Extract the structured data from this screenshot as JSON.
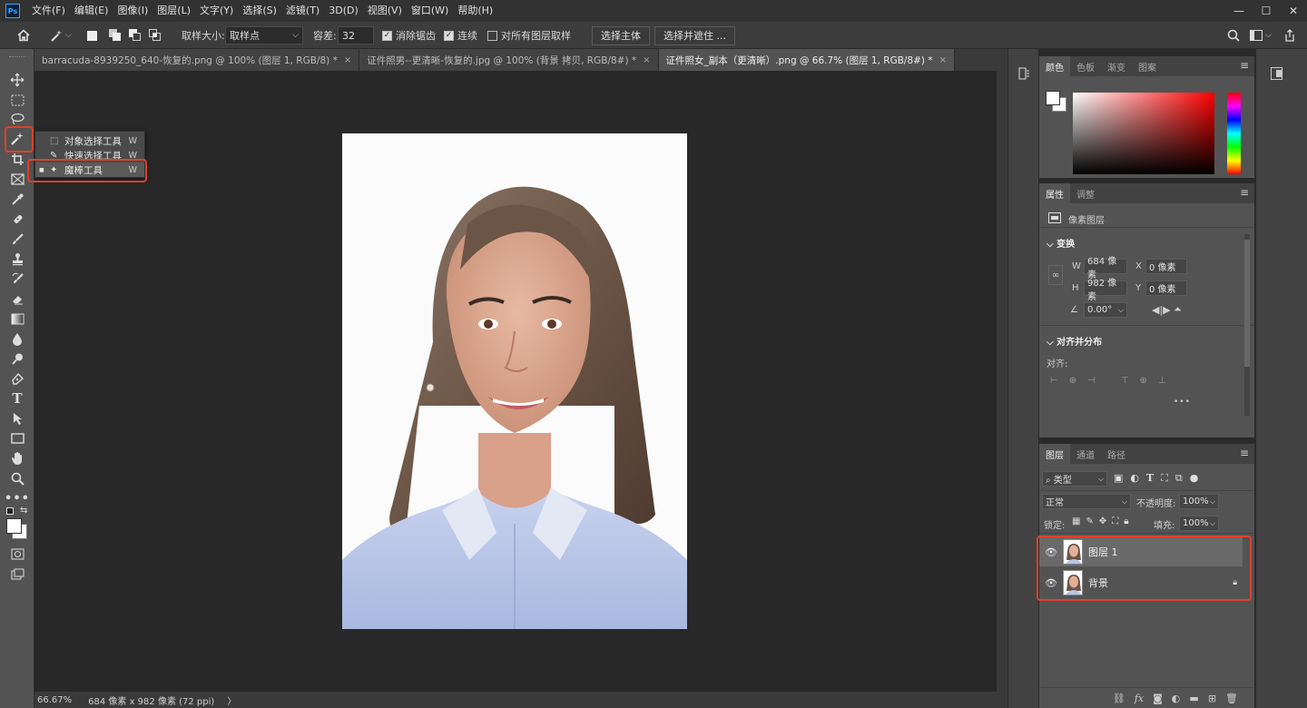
{
  "app": {
    "logo_text": "Ps",
    "accent": "#31a8ff",
    "highlight_color": "#e0402a"
  },
  "menu": [
    "文件(F)",
    "编辑(E)",
    "图像(I)",
    "图层(L)",
    "文字(Y)",
    "选择(S)",
    "滤镜(T)",
    "3D(D)",
    "视图(V)",
    "窗口(W)",
    "帮助(H)"
  ],
  "window_controls": [
    "minimize-icon",
    "restore-icon",
    "close-icon"
  ],
  "options": {
    "home_icon": "home-icon",
    "sample_size_label": "取样大小:",
    "sample_size_value": "取样点",
    "tolerance_label": "容差:",
    "tolerance_value": "32",
    "anti_alias_label": "消除锯齿",
    "anti_alias_checked": true,
    "contiguous_label": "连续",
    "contiguous_checked": true,
    "sample_all_label": "对所有图层取样",
    "sample_all_checked": false,
    "select_subject": "选择主体",
    "select_mask": "选择并遮住 ..."
  },
  "tabs": [
    {
      "label": "barracuda-8939250_640-恢复的.png @ 100% (图层 1, RGB/8) *",
      "close": "×",
      "active": false
    },
    {
      "label": "证件照男--更清晰-恢复的.jpg @ 100% (背景 拷贝, RGB/8#) *",
      "close": "×",
      "active": false
    },
    {
      "label": "证件照女_副本（更清晰）.png @ 66.7% (图层 1, RGB/8#) *",
      "close": "×",
      "active": true
    }
  ],
  "flyout": {
    "items": [
      {
        "label": "对象选择工具",
        "key": "W",
        "icon": "object-select-icon"
      },
      {
        "label": "快速选择工具",
        "key": "W",
        "icon": "quick-select-icon"
      },
      {
        "label": "魔棒工具",
        "key": "W",
        "icon": "magic-wand-icon",
        "selected": true
      }
    ]
  },
  "status": {
    "zoom": "66.67%",
    "info": "684 像素 x 982 像素 (72 ppi)",
    "arrow": "〉"
  },
  "color_panel": {
    "tabs": [
      "颜色",
      "色板",
      "渐变",
      "图案"
    ],
    "active": "颜色",
    "hue": "#ff0000"
  },
  "properties": {
    "tabs": [
      "属性",
      "调整"
    ],
    "active": "属性",
    "type": "像素图层",
    "transform_title": "变换",
    "w_label": "W",
    "w_value": "684 像素",
    "x_label": "X",
    "x_value": "0 像素",
    "h_label": "H",
    "h_value": "982 像素",
    "y_label": "Y",
    "y_value": "0 像素",
    "angle_value": "0.00°",
    "align_title": "对齐并分布",
    "align_label": "对齐:",
    "more": "•••",
    "cut_text": "... ..."
  },
  "layers": {
    "tabs": [
      "图层",
      "通道",
      "路径"
    ],
    "active": "图层",
    "filter_value": "类型",
    "blend_mode": "正常",
    "opacity_label": "不透明度:",
    "opacity_value": "100%",
    "lock_label": "锁定:",
    "fill_label": "填充:",
    "fill_value": "100%",
    "items": [
      {
        "name": "图层 1",
        "selected": true,
        "locked": false
      },
      {
        "name": "背景",
        "selected": false,
        "locked": true
      }
    ]
  }
}
